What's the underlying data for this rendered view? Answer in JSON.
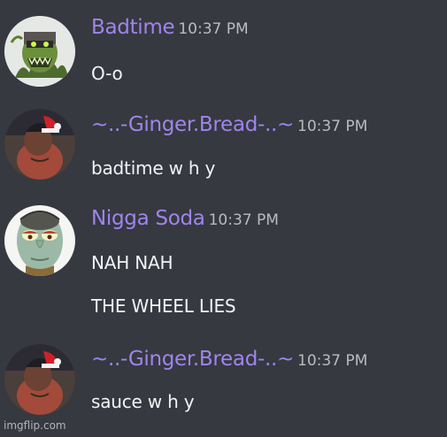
{
  "messages": [
    {
      "author": "Badtime",
      "timestamp": "10:37 PM",
      "avatar_icon": "zombie-avatar",
      "lines": [
        "O-o"
      ]
    },
    {
      "author": "~..-Ginger.Bread-..~",
      "timestamp": "10:37 PM",
      "avatar_icon": "santa-hat-avatar",
      "lines": [
        "badtime w h y"
      ]
    },
    {
      "author": "Nigga Soda",
      "timestamp": "10:37 PM",
      "avatar_icon": "squidward-avatar",
      "lines": [
        "NAH NAH",
        "THE WHEEL LIES"
      ]
    },
    {
      "author": "~..-Ginger.Bread-..~",
      "timestamp": "10:37 PM",
      "avatar_icon": "santa-hat-avatar",
      "lines": [
        "sauce w h y"
      ]
    }
  ],
  "watermark": "imgflip.com",
  "colors": {
    "background": "#36393f",
    "username": "#a084ee",
    "timestamp": "#b9bbbe",
    "text": "#f2f3f5"
  }
}
